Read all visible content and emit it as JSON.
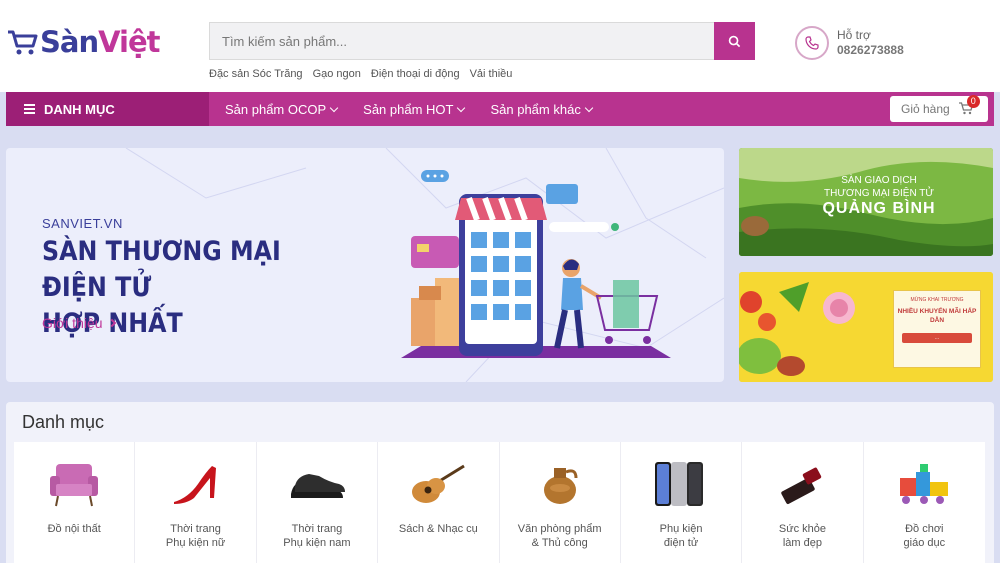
{
  "brand": {
    "logo_s": "S",
    "logo_rest_a": "àn",
    "logo_rest_b": "Việt",
    "accent": "#b8338f",
    "dark_accent": "#9c1f76",
    "navy": "#2a2d80"
  },
  "search": {
    "placeholder": "Tìm kiếm sản phẩm...",
    "suggestions": [
      "Đặc sản Sóc Trăng",
      "Gạo ngon",
      "Điện thoại di động",
      "Vải thiều"
    ]
  },
  "support": {
    "label": "Hỗ trợ",
    "phone": "0826273888"
  },
  "nav": {
    "category_label": "DANH MỤC",
    "items": [
      "Sản phẩm OCOP",
      "Sản phẩm HOT",
      "Sản phẩm khác"
    ],
    "cart_label": "Giỏ hàng",
    "cart_count": "0"
  },
  "hero": {
    "site": "SANVIET.VN",
    "title_line1": "SÀN THƯƠNG MẠI ĐIỆN TỬ",
    "title_line2": "HỢP NHẤT",
    "link": "Giới thiệu"
  },
  "banner1": {
    "line1": "SÀN GIAO DỊCH",
    "line2": "THƯƠNG MẠI ĐIỆN TỬ",
    "line3": "QUẢNG BÌNH"
  },
  "banner2": {
    "line1": "MỪNG KHAI TRƯƠNG",
    "line2": "NHIỀU KHUYẾN MÃI HẤP DẪN",
    "line3": "..."
  },
  "categories": {
    "title": "Danh mục",
    "items": [
      {
        "label": "Đồ nội thất",
        "icon": "armchair-icon"
      },
      {
        "label": "Thời trang\nPhụ kiện nữ",
        "icon": "high-heel-icon"
      },
      {
        "label": "Thời trang\nPhụ kiện nam",
        "icon": "mens-shoes-icon"
      },
      {
        "label": "Sách & Nhạc cụ",
        "icon": "guitar-icon"
      },
      {
        "label": "Văn phòng phẩm\n& Thủ công",
        "icon": "pottery-icon"
      },
      {
        "label": "Phụ kiện\nđiện tử",
        "icon": "smartphones-icon"
      },
      {
        "label": "Sức khỏe\nlàm đẹp",
        "icon": "lipstick-icon"
      },
      {
        "label": "Đồ chơi\ngiáo dục",
        "icon": "toy-train-icon"
      }
    ]
  }
}
